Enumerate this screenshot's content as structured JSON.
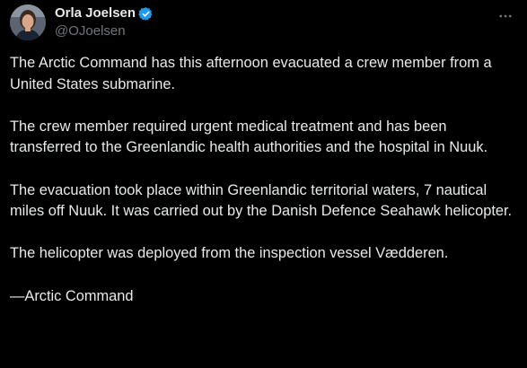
{
  "author": {
    "display_name": "Orla Joelsen",
    "handle": "@OJoelsen",
    "verified": true,
    "verified_color": "#1d9bf0"
  },
  "menu_icon": "more-horizontal-icon",
  "post": {
    "paragraphs": [
      "The Arctic Command has this afternoon evacuated a crew member from a United States submarine.",
      "The crew member required urgent medical treatment and has been transferred to the Greenlandic health authorities and the hospital in Nuuk.",
      "The evacuation took place within Greenlandic territorial waters, 7 nautical miles off Nuuk. It was carried out by the Danish Defence Seahawk helicopter.",
      "The helicopter was deployed from the inspection vessel Vædderen.",
      "—Arctic Command"
    ]
  },
  "colors": {
    "background": "#000000",
    "text": "#e7e9ea",
    "secondary_text": "#71767b"
  }
}
